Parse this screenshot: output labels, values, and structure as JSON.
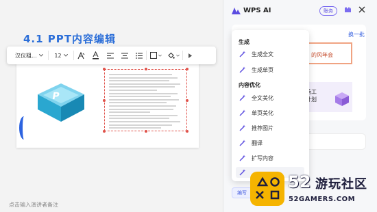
{
  "editor": {
    "slide_title": "4.1 PPT内容编辑",
    "notes_placeholder": "点击输入演讲者备注",
    "textbox_lines": 18
  },
  "toolbar": {
    "font_name": "汉仪粗...",
    "font_size": "12",
    "icons": [
      "text-clear-icon",
      "font-color-icon",
      "align-left-icon",
      "align-center-icon",
      "list-icon",
      "border-icon",
      "fill-icon",
      "more-icon"
    ]
  },
  "panel": {
    "title": "WPS AI",
    "account_label": "账务",
    "swap_label": "换一批",
    "thumb1_text": "的风年会",
    "thumb2_line1": "场工",
    "thumb2_line2": "计划",
    "bottom_label": "编写"
  },
  "menu": {
    "section_generate": "生成",
    "generate_items": [
      "生成全文",
      "生成单页"
    ],
    "section_optimize": "内容优化",
    "optimize_items": [
      "全文美化",
      "单页美化",
      "推荐图片",
      "翻译",
      "扩写内容"
    ]
  },
  "watermark": {
    "number": "52",
    "name": "游玩社区",
    "url": "52GAMERS.COM"
  },
  "colors": {
    "accent": "#5b4ce0",
    "title_blue": "#2b6ed8",
    "selection_red": "#e0524a"
  }
}
